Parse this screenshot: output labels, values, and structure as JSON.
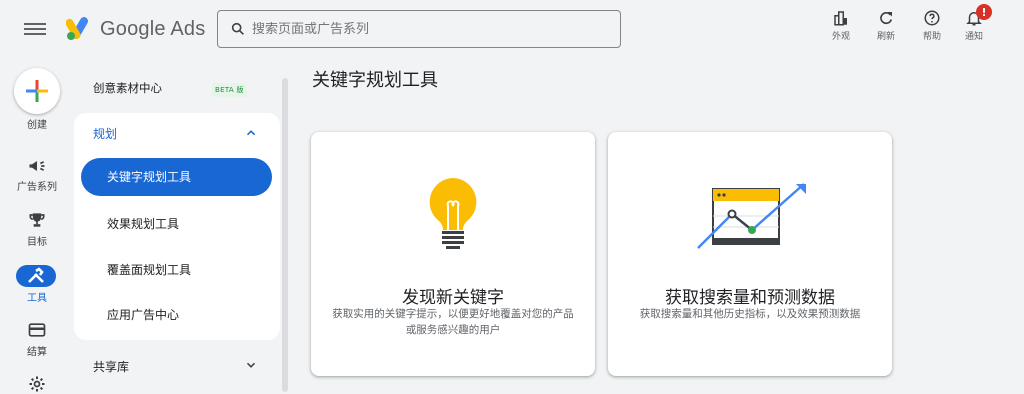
{
  "header": {
    "brand": "Google Ads",
    "search_placeholder": "搜索页面或广告系列",
    "actions": [
      {
        "label": "外观",
        "icon": "appearance-icon"
      },
      {
        "label": "刷新",
        "icon": "refresh-icon"
      },
      {
        "label": "帮助",
        "icon": "help-icon"
      },
      {
        "label": "通知",
        "icon": "bell-icon",
        "badge": "!"
      }
    ]
  },
  "rail": {
    "create_label": "创建",
    "items": [
      {
        "label": "广告系列",
        "icon": "megaphone-icon"
      },
      {
        "label": "目标",
        "icon": "trophy-icon"
      },
      {
        "label": "工具",
        "icon": "tools-icon",
        "active": true
      },
      {
        "label": "结算",
        "icon": "card-icon"
      },
      {
        "label": "",
        "icon": "gear-icon"
      }
    ]
  },
  "nav": {
    "creative_center": "创意素材中心",
    "beta_badge": "BETA 版",
    "planning": "规划",
    "items": [
      "关键字规划工具",
      "效果规划工具",
      "覆盖面规划工具",
      "应用广告中心"
    ],
    "shared_library": "共享库"
  },
  "main": {
    "title": "关键字规划工具",
    "cards": [
      {
        "title": "发现新关键字",
        "desc": "获取实用的关键字提示，以便更好地覆盖对您的产品或服务感兴趣的用户",
        "icon": "lightbulb-icon"
      },
      {
        "title": "获取搜索量和预测数据",
        "desc": "获取搜索量和其他历史指标，以及效果预测数据",
        "icon": "forecast-chart-icon"
      }
    ]
  },
  "colors": {
    "accent": "#1967d2",
    "background": "#f1f3f4",
    "bulb": "#fbbc04",
    "badge": "#d93025"
  }
}
